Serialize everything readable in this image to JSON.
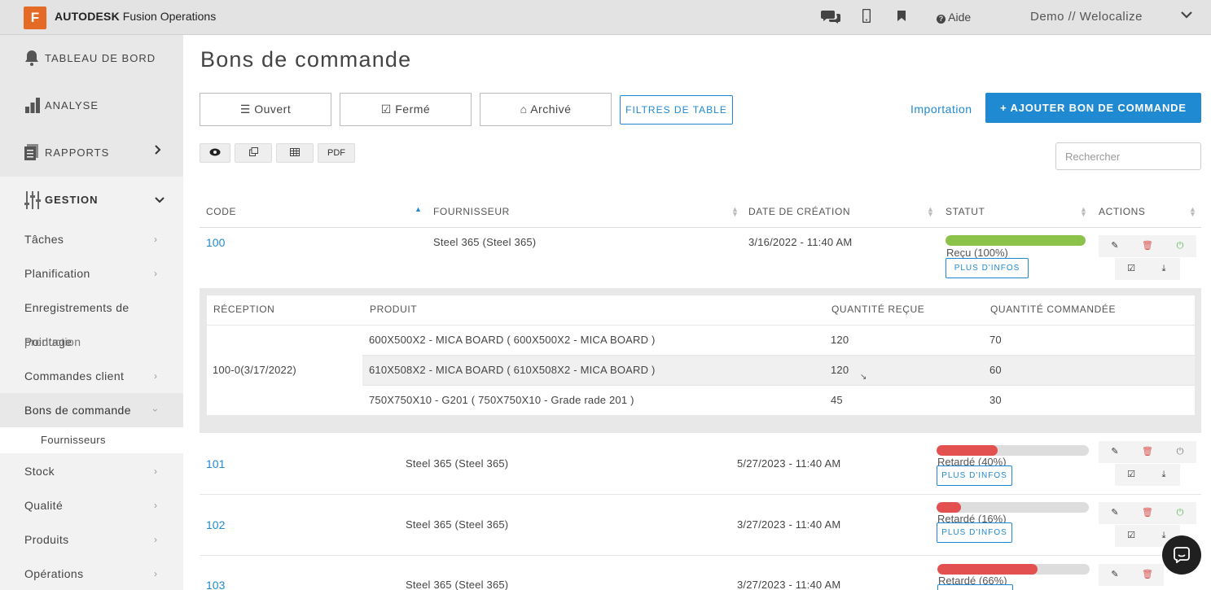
{
  "app": {
    "logo_letter": "F",
    "brand_bold": "AUTODESK",
    "brand_rest": " Fusion Operations",
    "aide": "Aide",
    "user": "Demo // Welocalize"
  },
  "sidebar": {
    "main": [
      {
        "label": "TABLEAU DE BORD",
        "icon": "bell-icon"
      },
      {
        "label": "ANALYSE",
        "icon": "bar-chart-icon"
      },
      {
        "label": "RAPPORTS",
        "icon": "report-icon"
      },
      {
        "label": "GESTION",
        "icon": "sliders-icon"
      }
    ],
    "sub": [
      "Tâches",
      "Planification",
      "Enregistrements de",
      "Pointage",
      "Commandes client",
      "Bons de commande",
      "Fournisseurs",
      "Stock",
      "Qualité",
      "Produits",
      "Opérations"
    ],
    "overlap_text": "production"
  },
  "page": {
    "title": "Bons de commande",
    "filters": [
      "Ouvert",
      "Fermé",
      "Archivé"
    ],
    "filtres_table": "FILTRES DE TABLE",
    "importation": "Importation",
    "add_label": "AJOUTER BON DE COMMANDE",
    "pdf": "PDF",
    "search_placeholder": "Rechercher"
  },
  "table": {
    "headers": [
      "CODE",
      "FOURNISSEUR",
      "DATE DE CRÉATION",
      "STATUT",
      "ACTIONS"
    ],
    "plus_infos": "PLUS D'INFOS",
    "rows": [
      {
        "code": "100",
        "supplier": "Steel 365 (Steel 365)",
        "date": "3/16/2022 - 11:40 AM",
        "status": "Reçu (100%)",
        "progress": 100,
        "color": "#8bc34a"
      },
      {
        "code": "101",
        "supplier": "Steel 365 (Steel 365)",
        "date": "5/27/2023 - 11:40 AM",
        "status": "Retardé (40%)",
        "progress": 40,
        "color": "#e35050"
      },
      {
        "code": "102",
        "supplier": "Steel 365 (Steel 365)",
        "date": "3/27/2023 - 11:40 AM",
        "status": "Retardé (16%)",
        "progress": 16,
        "color": "#e35050"
      },
      {
        "code": "103",
        "supplier": "Steel 365 (Steel 365)",
        "date": "3/27/2023 - 11:40 AM",
        "status": "Retardé (66%)",
        "progress": 66,
        "color": "#e35050"
      }
    ]
  },
  "reception": {
    "headers": [
      "RÉCEPTION",
      "PRODUIT",
      "QUANTITÉ REÇUE",
      "QUANTITÉ COMMANDÉE"
    ],
    "reception_label": "100-0(3/17/2022)",
    "items": [
      {
        "product": "600X500X2 - MICA BOARD ( 600X500X2 - MICA BOARD )",
        "received": "120",
        "ordered": "70"
      },
      {
        "product": "610X508X2 - MICA BOARD ( 610X508X2 - MICA BOARD )",
        "received": "120",
        "ordered": "60"
      },
      {
        "product": "750X750X10 - G201 ( 750X750X10 - Grade rade 201 )",
        "received": "45",
        "ordered": "30"
      }
    ]
  }
}
